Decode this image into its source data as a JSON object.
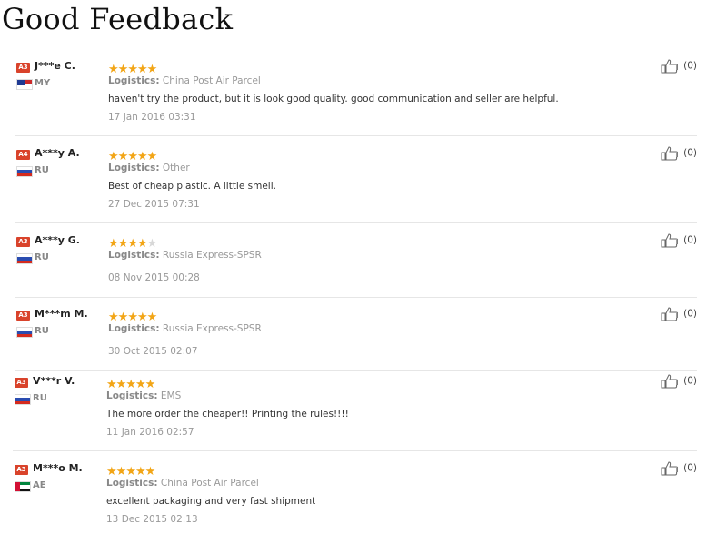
{
  "title": "Good Feedback",
  "colors": {
    "star": "#f2a516",
    "badge": "#d9432b",
    "divider": "#e6e6e6"
  },
  "logistics_label": "Logistics:",
  "reviews": [
    {
      "badge": "A3",
      "name": "J***e C.",
      "country": "MY",
      "flag": "my-flag",
      "rating": 5,
      "logistics": "China Post Air Parcel",
      "text": "haven't try the product, but it is look good quality. good communication and seller are helpful.",
      "date": "17 Jan 2016 03:31",
      "likes": "(0)"
    },
    {
      "badge": "A4",
      "name": "A***y A.",
      "country": "RU",
      "flag": "ru-flag",
      "rating": 5,
      "logistics": "Other",
      "text": "Best of cheap plastic. A little smell.",
      "date": "27 Dec 2015 07:31",
      "likes": "(0)"
    },
    {
      "badge": "A3",
      "name": "A***y G.",
      "country": "RU",
      "flag": "ru-flag",
      "rating": 4,
      "logistics": "Russia Express-SPSR",
      "text": "",
      "date": "08 Nov 2015 00:28",
      "likes": "(0)"
    },
    {
      "badge": "A3",
      "name": "M***m M.",
      "country": "RU",
      "flag": "ru-flag",
      "rating": 5,
      "logistics": "Russia Express-SPSR",
      "text": "",
      "date": "30 Oct 2015 02:07",
      "likes": "(0)"
    },
    {
      "badge": "A3",
      "name": "V***r V.",
      "country": "RU",
      "flag": "ru-flag",
      "rating": 5,
      "logistics": "EMS",
      "text": "The more order the cheaper!! Printing the rules!!!!",
      "date": "11 Jan 2016 02:57",
      "likes": "(0)"
    },
    {
      "badge": "A3",
      "name": "M***o M.",
      "country": "AE",
      "flag": "ae-flag",
      "rating": 5,
      "logistics": "China Post Air Parcel",
      "text": "excellent packaging and very fast shipment",
      "date": "13 Dec 2015 02:13",
      "likes": "(0)"
    }
  ]
}
